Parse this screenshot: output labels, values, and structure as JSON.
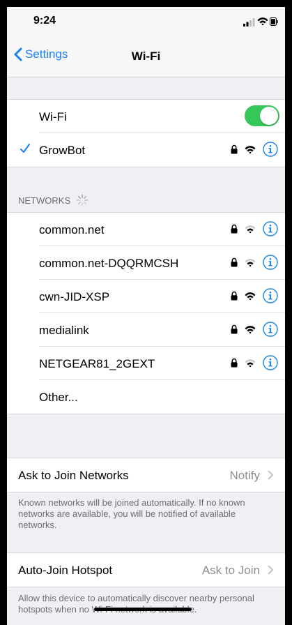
{
  "status_bar": {
    "time": "9:24",
    "icons": [
      "signal-icon",
      "wifi-icon",
      "battery-icon"
    ]
  },
  "nav": {
    "back_label": "Settings",
    "title": "Wi-Fi"
  },
  "wifi": {
    "label": "Wi-Fi",
    "enabled": true
  },
  "connected": {
    "name": "GrowBot",
    "secured": true
  },
  "networks_header": "NETWORKS",
  "networks": [
    {
      "name": "common.net",
      "secured": true
    },
    {
      "name": "common.net-DQQRMCSH",
      "secured": true
    },
    {
      "name": "cwn-JID-XSP",
      "secured": true
    },
    {
      "name": "medialink",
      "secured": true
    },
    {
      "name": "NETGEAR81_2GEXT",
      "secured": true
    }
  ],
  "other_label": "Other...",
  "ask_to_join": {
    "label": "Ask to Join Networks",
    "value": "Notify",
    "footnote": "Known networks will be joined automatically. If no known networks are available, you will be notified of available networks."
  },
  "auto_join": {
    "label": "Auto-Join Hotspot",
    "value": "Ask to Join",
    "footnote": "Allow this device to automatically discover nearby personal hotspots when no Wi-Fi network is available."
  },
  "colors": {
    "accent": "#1982f6",
    "toggle_on": "#35c759",
    "background": "#efeff4"
  }
}
